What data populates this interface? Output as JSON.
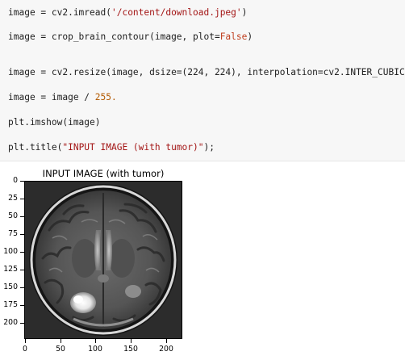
{
  "code_cell": {
    "lines": [
      {
        "parts": [
          {
            "t": "image = cv2.imread(",
            "c": ""
          },
          {
            "t": "'/content/download.jpeg'",
            "c": "str"
          },
          {
            "t": ")",
            "c": ""
          }
        ]
      },
      {
        "parts": [
          {
            "t": "image = crop_brain_contour(image, plot=",
            "c": ""
          },
          {
            "t": "False",
            "c": "kw"
          },
          {
            "t": ")",
            "c": ""
          }
        ]
      },
      {
        "parts": [
          {
            "t": "image = cv2.resize(image, dsize=(224, 224), interpolation=cv2.INTER_CUBIC)",
            "c": ""
          }
        ]
      },
      {
        "parts": [
          {
            "t": "image = image / ",
            "c": ""
          },
          {
            "t": "255.",
            "c": "num"
          }
        ]
      },
      {
        "parts": [
          {
            "t": "plt.imshow(image)",
            "c": ""
          }
        ]
      },
      {
        "parts": [
          {
            "t": "plt.title(",
            "c": ""
          },
          {
            "t": "\"INPUT IMAGE (with tumor)\"",
            "c": "str"
          },
          {
            "t": ");",
            "c": ""
          }
        ]
      }
    ]
  },
  "output": {
    "plot_title": "INPUT IMAGE (with tumor)",
    "y_ticks": [
      "0",
      "25",
      "50",
      "75",
      "100",
      "125",
      "150",
      "175",
      "200"
    ],
    "x_ticks": [
      "0",
      "50",
      "100",
      "150",
      "200"
    ],
    "image_size": 224,
    "image_alt": "brain MRI scan"
  }
}
